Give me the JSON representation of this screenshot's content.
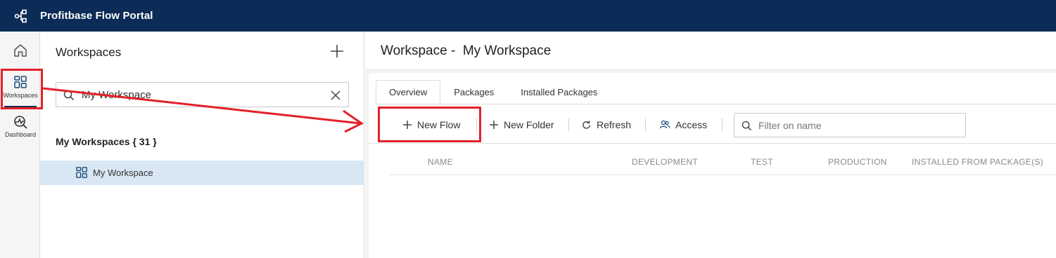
{
  "app": {
    "title": "Profitbase Flow Portal",
    "brand_color": "#0c2c57",
    "highlight_color": "#e3202a"
  },
  "rail": {
    "items": [
      {
        "icon": "home-icon",
        "label": ""
      },
      {
        "icon": "workspaces-icon",
        "label": "Workspaces",
        "active": true
      },
      {
        "icon": "dashboard-icon",
        "label": "Dashboard"
      }
    ]
  },
  "workspaces_panel": {
    "title": "Workspaces",
    "search_value": "My Workspace",
    "group_label": "My Workspaces { 31 }",
    "items": [
      {
        "label": "My Workspace",
        "selected": true
      }
    ]
  },
  "main": {
    "title": "Workspace -  My Workspace",
    "tabs": [
      {
        "label": "Overview",
        "active": true
      },
      {
        "label": "Packages"
      },
      {
        "label": "Installed Packages"
      }
    ],
    "toolbar": {
      "new_flow": "New Flow",
      "new_folder": "New Folder",
      "refresh": "Refresh",
      "access": "Access",
      "filter_placeholder": "Filter on name"
    },
    "columns": [
      "NAME",
      "DEVELOPMENT",
      "TEST",
      "PRODUCTION",
      "INSTALLED FROM PACKAGE(S)"
    ]
  }
}
